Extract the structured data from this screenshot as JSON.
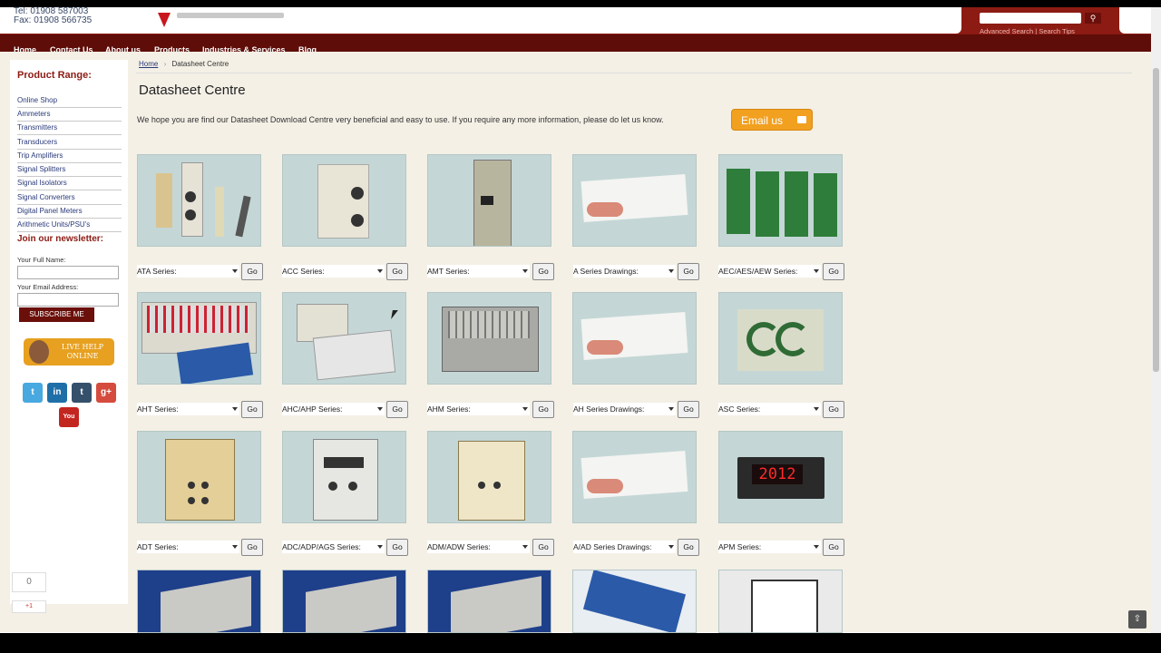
{
  "header": {
    "tel": "Tel: 01908 587003",
    "fax": "Fax: 01908 566735",
    "search_links": "Advanced Search | Search Tips"
  },
  "nav": [
    "Home",
    "Contact Us",
    "About us",
    "Products",
    "Industries & Services",
    "Blog"
  ],
  "sidebar": {
    "title": "Product Range:",
    "items": [
      "Online Shop",
      "Ammeters",
      "Transmitters",
      "Transducers",
      "Trip Amplifiers",
      "Signal Splitters",
      "Signal Isolators",
      "Signal Converters",
      "Digital Panel Meters",
      "Arithmetic Units/PSU's"
    ],
    "newsletter_title": "Join our newsletter:",
    "name_label": "Your Full Name:",
    "email_label": "Your Email Address:",
    "subscribe": "SUBSCRIBE ME",
    "live_help": "LIVE HELP ONLINE",
    "social": {
      "twitter": "t",
      "linkedin": "in",
      "tumblr": "t",
      "gplus": "g+",
      "youtube": "You"
    },
    "counter": "0",
    "plus_one": "+1"
  },
  "breadcrumb": {
    "home": "Home",
    "sep": "›",
    "current": "Datasheet Centre"
  },
  "page": {
    "title": "Datasheet Centre",
    "intro": "We hope you are find our Datasheet Download Centre very beneficial and easy to use. If you require any more information, please do let us know.",
    "email_button": "Email us"
  },
  "go_label": "Go",
  "datasheets": [
    [
      "ATA Series:",
      "ACC Series:",
      "AMT Series:",
      "A Series Drawings:",
      "AEC/AES/AEW Series:"
    ],
    [
      "AHT Series:",
      "AHC/AHP Series:",
      "AHM Series:",
      "AH Series Drawings:",
      "ASC Series:"
    ],
    [
      "ADT Series:",
      "ADC/ADP/AGS Series:",
      "ADM/ADW Series:",
      "A/AD Series Drawings:",
      "APM Series:"
    ]
  ],
  "apm_display": "2012"
}
